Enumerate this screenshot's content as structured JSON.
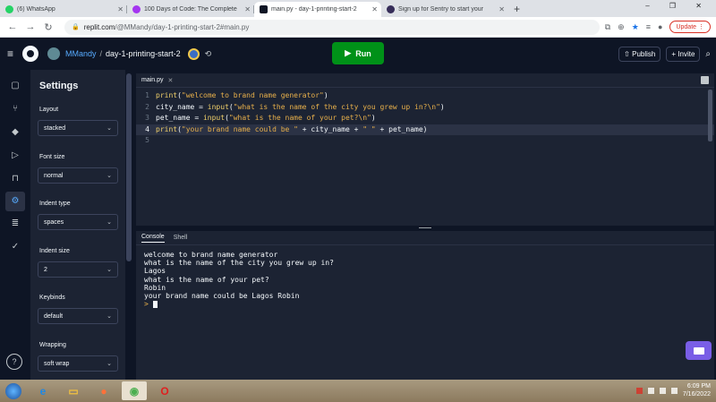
{
  "browser": {
    "tabs": [
      {
        "title": "(6) WhatsApp",
        "color": "#25d366"
      },
      {
        "title": "100 Days of Code: The Complete",
        "color": "#a435f0"
      },
      {
        "title": "main.py - day-1-printing-start-2",
        "color": "#0e1525"
      },
      {
        "title": "Sign up for Sentry to start your",
        "color": "#362d59"
      }
    ],
    "url_host": "replit.com",
    "url_path": "/@MMandy/day-1-printing-start-2#main.py",
    "update_label": "Update"
  },
  "header": {
    "user": "MMandy",
    "separator": "/",
    "repl_name": "day-1-printing-start-2",
    "run_label": "Run",
    "publish_label": "Publish",
    "invite_label": "Invite"
  },
  "settings": {
    "title": "Settings",
    "layout_label": "Layout",
    "layout_value": "stacked",
    "font_size_label": "Font size",
    "font_size_value": "normal",
    "indent_type_label": "Indent type",
    "indent_type_value": "spaces",
    "indent_size_label": "Indent size",
    "indent_size_value": "2",
    "keybinds_label": "Keybinds",
    "keybinds_value": "default",
    "wrapping_label": "Wrapping",
    "wrapping_value": "soft wrap"
  },
  "editor": {
    "file_tab": "main.py",
    "lines": [
      {
        "n": "1",
        "code": [
          {
            "t": "print",
            "c": "f"
          },
          {
            "t": "(",
            "c": ""
          },
          {
            "t": "\"welcome to brand name generator\"",
            "c": "s"
          },
          {
            "t": ")",
            "c": ""
          }
        ]
      },
      {
        "n": "2",
        "code": [
          {
            "t": "city_name = ",
            "c": ""
          },
          {
            "t": "input",
            "c": "f"
          },
          {
            "t": "(",
            "c": ""
          },
          {
            "t": "\"what is the name of the city you grew up in?\\n\"",
            "c": "s"
          },
          {
            "t": ")",
            "c": ""
          }
        ]
      },
      {
        "n": "3",
        "code": [
          {
            "t": "pet_name = ",
            "c": ""
          },
          {
            "t": "input",
            "c": "f"
          },
          {
            "t": "(",
            "c": ""
          },
          {
            "t": "\"what is the name of your pet?\\n\"",
            "c": "s"
          },
          {
            "t": ")",
            "c": ""
          }
        ]
      },
      {
        "n": "4",
        "code": [
          {
            "t": "print",
            "c": "f"
          },
          {
            "t": "(",
            "c": ""
          },
          {
            "t": "\"your brand name could be \"",
            "c": "s"
          },
          {
            "t": " + city_name + ",
            "c": ""
          },
          {
            "t": "\" \"",
            "c": "s"
          },
          {
            "t": " + pet_name)",
            "c": ""
          }
        ]
      },
      {
        "n": "5",
        "code": []
      }
    ],
    "current_line": "4"
  },
  "console": {
    "tabs": [
      "Console",
      "Shell"
    ],
    "output": [
      "welcome to brand name generator",
      "what is the name of the city you grew up in?",
      "Lagos",
      "what is the name of your pet?",
      "Robin",
      "your brand name could be Lagos Robin"
    ],
    "prompt": ">"
  },
  "taskbar": {
    "time": "6:09 PM",
    "date": "7/16/2022"
  }
}
